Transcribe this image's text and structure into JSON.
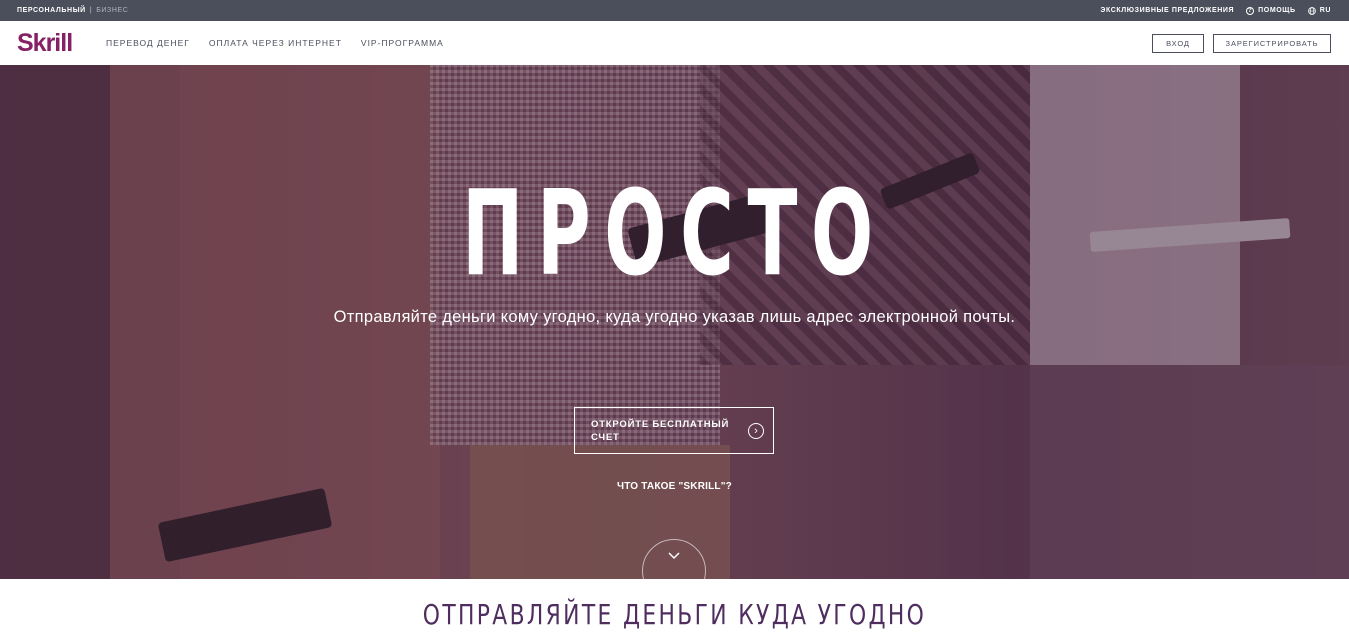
{
  "topbar": {
    "personal": "ПЕРСОНАЛЬНЫЙ",
    "separator": "|",
    "business": "БИЗНЕС",
    "offers": "ЭКСКЛЮЗИВНЫЕ ПРЕДЛОЖЕНИЯ",
    "help": "ПОМОЩЬ",
    "help_icon": "question-circle-icon",
    "language": "RU",
    "language_icon": "globe-icon"
  },
  "nav": {
    "logo": "Skrill",
    "menu": [
      "ПЕРЕВОД ДЕНЕГ",
      "ОПЛАТА ЧЕРЕЗ ИНТЕРНЕТ",
      "VIP-ПРОГРАММА"
    ],
    "login": "ВХОД",
    "register": "ЗАРЕГИСТРИРОВАТЬ"
  },
  "hero": {
    "title": "ПРОСТО",
    "subtitle": "Отправляйте деньги кому угодно, куда угодно указав лишь адрес электронной почты.",
    "cta": "ОТКРОЙТЕ БЕСПЛАТНЫЙ СЧЕТ",
    "cta_icon": "arrow-right-circle-icon",
    "what_link": "ЧТО ТАКОЕ \"SKRILL\"?",
    "scroll_icon": "chevron-down-icon"
  },
  "section": {
    "title": "ОТПРАВЛЯЙТЕ ДЕНЬГИ КУДА УГОДНО"
  },
  "colors": {
    "brand": "#862165",
    "topbar": "#4b4f5c",
    "section_title": "#4f2d5e"
  }
}
